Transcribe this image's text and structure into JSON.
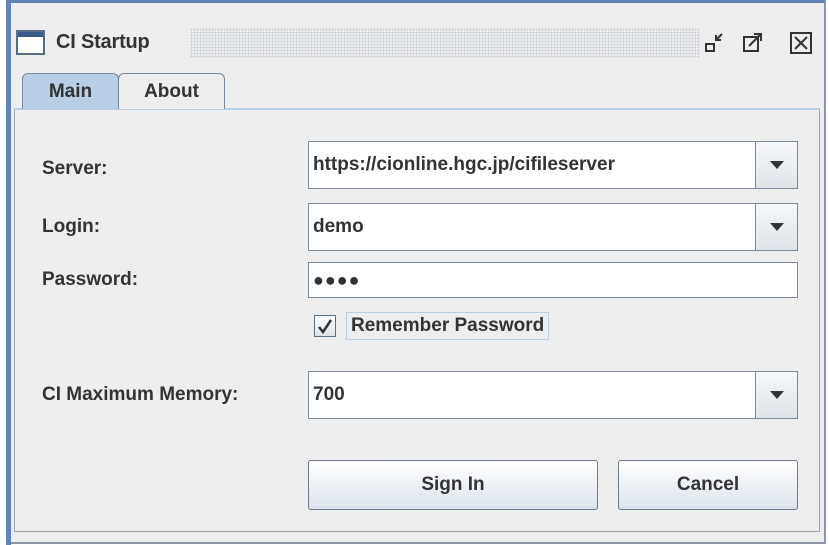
{
  "window": {
    "title": "CI Startup",
    "icon": "window-icon",
    "controls": [
      "minimize-icon",
      "maximize-icon",
      "close-icon"
    ]
  },
  "tabs": [
    {
      "label": "Main",
      "selected": true
    },
    {
      "label": "About",
      "selected": false
    }
  ],
  "form": {
    "server_label": "Server:",
    "server_value": "https://cionline.hgc.jp/cifileserver",
    "login_label": "Login:",
    "login_value": "demo",
    "password_label": "Password:",
    "password_value": "●●●●",
    "remember_label": "Remember Password",
    "remember_checked": true,
    "memory_label": "CI Maximum Memory:",
    "memory_value": "700"
  },
  "buttons": {
    "sign_in": "Sign In",
    "cancel": "Cancel"
  },
  "colors": {
    "accent": "#6383b5",
    "tab_selected": "#b8cfe5",
    "background": "#eeeeee"
  }
}
